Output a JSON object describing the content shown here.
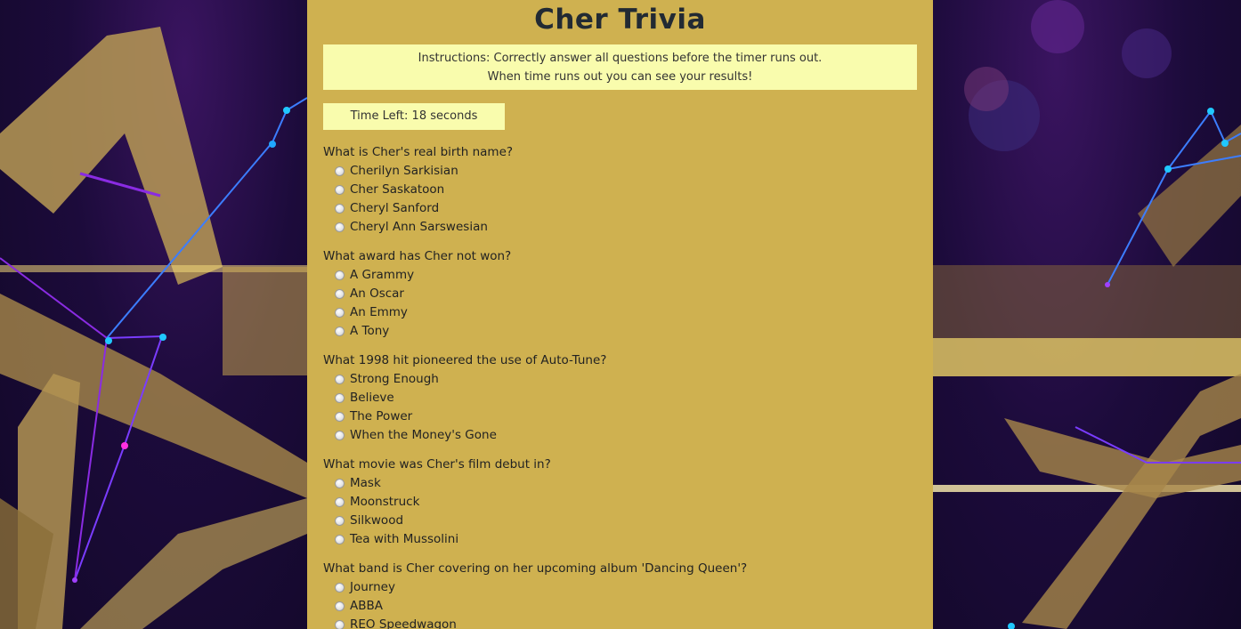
{
  "title": "Cher Trivia",
  "instructions": {
    "line1": "Instructions: Correctly answer all questions before the timer runs out.",
    "line2": "When time runs out you can see your results!"
  },
  "timer": {
    "text": "Time Left: 18 seconds"
  },
  "questions": [
    {
      "text": "What is Cher's real birth name?",
      "options": [
        "Cherilyn Sarkisian",
        "Cher Saskatoon",
        "Cheryl Sanford",
        "Cheryl Ann Sarswesian"
      ]
    },
    {
      "text": "What award has Cher not won?",
      "options": [
        "A Grammy",
        "An Oscar",
        "An Emmy",
        "A Tony"
      ]
    },
    {
      "text": "What 1998 hit pioneered the use of Auto-Tune?",
      "options": [
        "Strong Enough",
        "Believe",
        "The Power",
        "When the Money's Gone"
      ]
    },
    {
      "text": "What movie was Cher's film debut in?",
      "options": [
        "Mask",
        "Moonstruck",
        "Silkwood",
        "Tea with Mussolini"
      ]
    },
    {
      "text": "What band is Cher covering on her upcoming album 'Dancing Queen'?",
      "options": [
        "Journey",
        "ABBA",
        "REO Speedwagon"
      ]
    }
  ],
  "colors": {
    "panel": "#cfb150",
    "highlight": "#f9fcad",
    "title": "#222a33"
  }
}
